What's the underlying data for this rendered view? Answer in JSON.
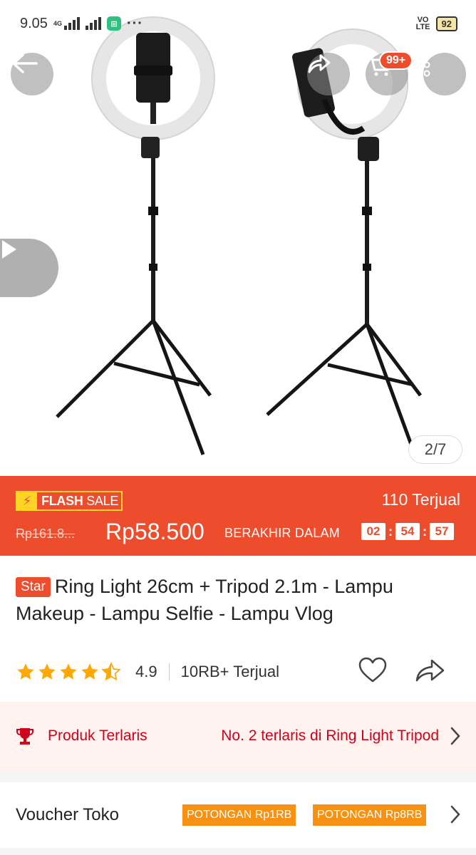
{
  "status_bar": {
    "time": "9.05",
    "network": "4G",
    "volte_top": "VO",
    "volte_bottom": "LTE",
    "battery": "92"
  },
  "top_nav": {
    "cart_badge": "99+"
  },
  "gallery": {
    "counter": "2/7"
  },
  "flash_sale": {
    "label_bold": "FLASH",
    "label_rest": "SALE",
    "sold": "110 Terjual",
    "original_price": "Rp161.8...",
    "price": "Rp58.500",
    "ends_label": "BERAKHIR DALAM",
    "timer": {
      "hours": "02",
      "minutes": "54",
      "seconds": "57"
    }
  },
  "product": {
    "tag": "Star",
    "title": "Ring Light 26cm + Tripod 2.1m - Lampu Makeup - Lampu Selfie - Lampu Vlog",
    "rating": "4.9",
    "rating_value": 4.5,
    "sold": "10RB+ Terjual"
  },
  "best_seller": {
    "label": "Produk Terlaris",
    "value": "No. 2 terlaris di Ring Light Tripod"
  },
  "voucher": {
    "label": "Voucher Toko",
    "tags": [
      "POTONGAN Rp1RB",
      "POTONGAN Rp8RB"
    ]
  },
  "colors": {
    "brand": "#ee4d2d",
    "flash_yellow": "#ffd424",
    "voucher_orange": "#f69113",
    "best_red": "#d0011b"
  }
}
